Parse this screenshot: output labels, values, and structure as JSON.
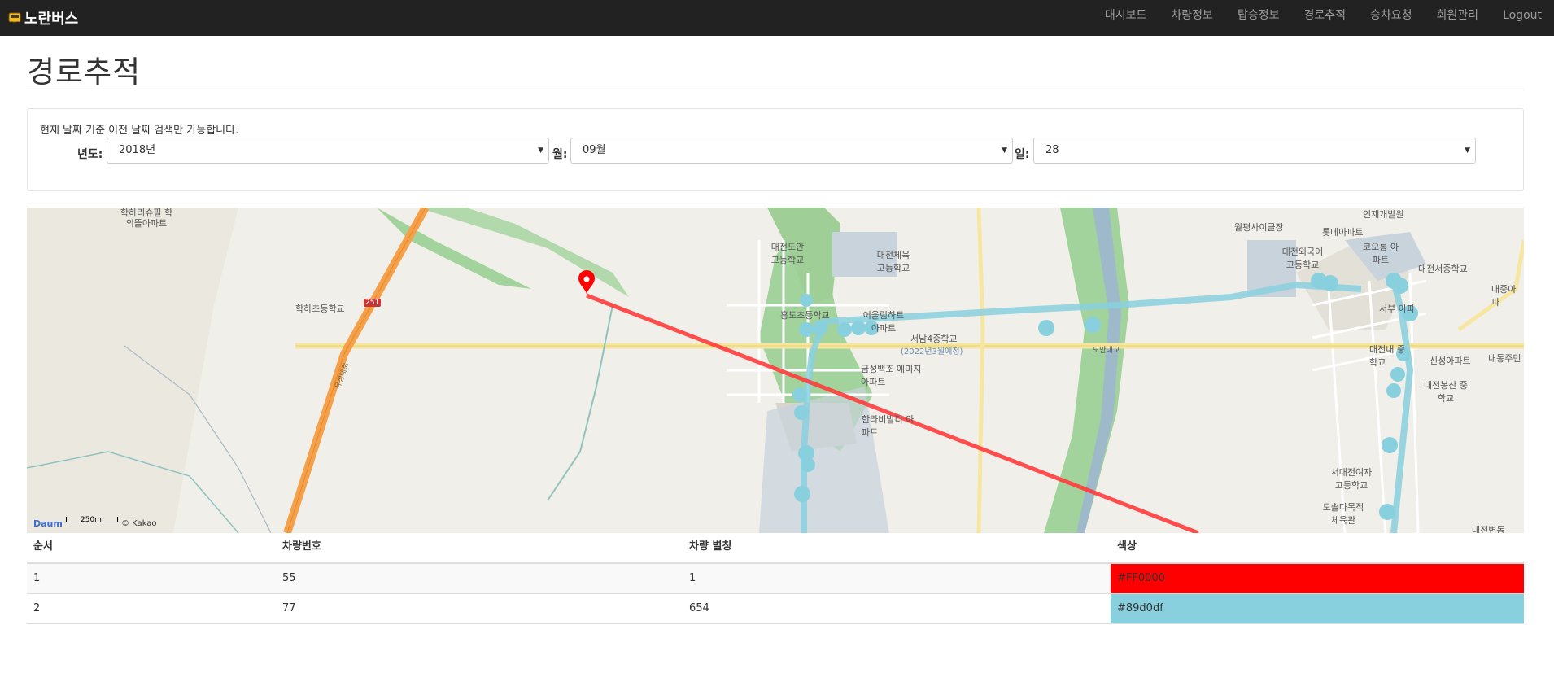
{
  "nav": {
    "brand": "노란버스",
    "items": [
      "대시보드",
      "차량정보",
      "탑승정보",
      "경로추적",
      "승차요청",
      "회원관리",
      "Logout"
    ]
  },
  "page": {
    "title": "경로추적"
  },
  "search": {
    "notice": "현재 날짜 기준 이전 날짜 검색만 가능합니다.",
    "year_label": "년도:",
    "year_value": "2018년",
    "month_label": "월:",
    "month_value": "09월",
    "day_label": "일:",
    "day_value": "28"
  },
  "map": {
    "scale_label": "250m",
    "copyright": "© Kakao",
    "logo": "Daum",
    "place_labels": [
      "학하리슈필 학의뜰아파트",
      "학하초등학교",
      "대전도안 고등학교",
      "대전체육 고등학교",
      "흥도초등학교",
      "어울림하트 아파트",
      "서남4중학교",
      "(2022년3월예정)",
      "금성백조 예미지아파트",
      "한라비발디 아파트",
      "도안대교",
      "월평사이클장",
      "롯데아파트",
      "인재개발원",
      "대전외국어 고등학교",
      "코오롱 아파트",
      "대전서중학교",
      "대중아파",
      "서부 아파",
      "대전내 중학교",
      "신성아파트",
      "대전봉산 중학교",
      "내동주민",
      "서대전여자 고등학교",
      "도솔다목적 체육관",
      "대전변동",
      "251",
      "유성대로"
    ],
    "route_colors": [
      "#FF0000",
      "#89d0df"
    ]
  },
  "table": {
    "headers": [
      "순서",
      "차량번호",
      "차량 별칭",
      "색상"
    ],
    "rows": [
      {
        "order": "1",
        "number": "55",
        "alias": "1",
        "color": "#FF0000"
      },
      {
        "order": "2",
        "number": "77",
        "alias": "654",
        "color": "#89d0df"
      }
    ]
  }
}
